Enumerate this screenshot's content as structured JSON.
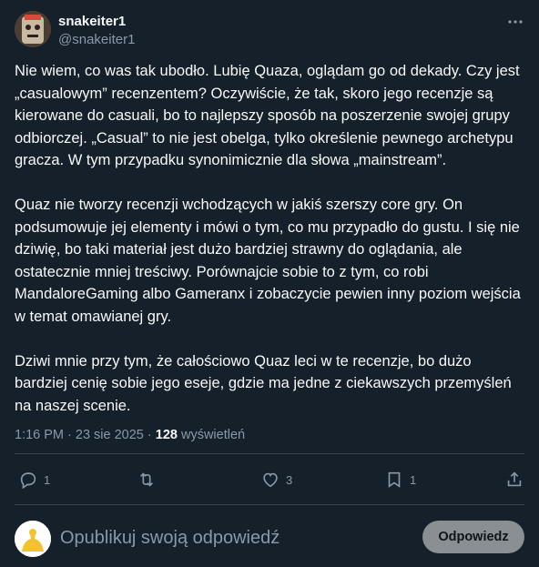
{
  "author": {
    "display_name": "snakeiter1",
    "handle": "@snakeiter1",
    "avatar_icon": "avatar-icon"
  },
  "more_icon": "ellipsis-icon",
  "post": {
    "paragraphs": [
      "Nie wiem, co was tak ubodło. Lubię Quaza, oglądam go od dekady. Czy jest „casualowym” recenzentem? Oczywiście, że tak, skoro jego recenzje są kierowane do casuali, bo to najlepszy sposób na poszerzenie swojej grupy odbiorczej. „Casual” to nie jest obelga, tylko określenie pewnego archetypu gracza. W tym przypadku synonimicznie dla słowa „mainstream”.",
      "Quaz nie tworzy recenzji wchodzących w jakiś szerszy core gry. On podsumowuje jej elementy i mówi o tym, co mu przypadło do gustu. I się nie dziwię, bo taki materiał jest dużo bardziej strawny do oglądania, ale ostatecznie mniej treściwy. Porównajcie sobie to z tym, co robi MandaloreGaming albo Gameranx i zobaczycie pewien inny poziom wejścia w temat omawianej gry.",
      "Dziwi mnie przy tym, że całościowo Quaz leci w te recenzje, bo dużo bardziej cenię sobie jego eseje, gdzie ma jedne z ciekawszych przemyśleń na naszej scenie."
    ]
  },
  "meta": {
    "time_date": "1:16 PM · 23 sie 2025 · ",
    "views_count": "128",
    "views_label": " wyświetleń"
  },
  "actions": {
    "reply_count": "1",
    "retweet_count": "",
    "like_count": "3",
    "bookmark_count": "1"
  },
  "reply": {
    "placeholder": "Opublikuj swoją odpowiedź",
    "button_label": "Odpowiedz"
  },
  "colors": {
    "background": "#15202b",
    "text": "#f7f9f9",
    "secondary_text": "#8b98a5",
    "divider": "#38444d",
    "button_bg": "#8a8f94"
  }
}
